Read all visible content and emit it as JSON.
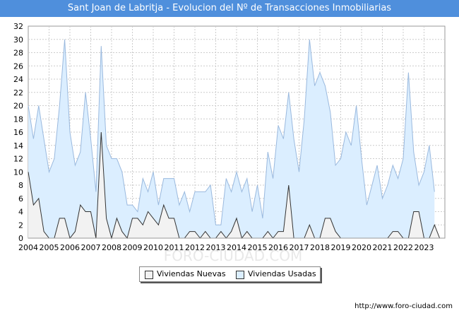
{
  "title": "Sant Joan de Labritja - Evolucion del Nº de Transacciones Inmobiliarias",
  "footer": "http://www.foro-ciudad.com",
  "watermark": "FORO-CIUDAD.COM",
  "colors": {
    "title_bg": "#4f8fdc",
    "usadas_fill": "#dbeeff",
    "usadas_line": "#9ab9de",
    "nuevas_fill": "#f2f2f2",
    "nuevas_line": "#333333",
    "grid": "#cccccc"
  },
  "chart_data": {
    "type": "area",
    "title": "Sant Joan de Labritja - Evolucion del Nº de Transacciones Inmobiliarias",
    "xlabel": "",
    "ylabel": "",
    "ylim": [
      0,
      32
    ],
    "y_ticks": [
      "0",
      "2",
      "4",
      "6",
      "8",
      "10",
      "12",
      "14",
      "16",
      "18",
      "20",
      "22",
      "24",
      "26",
      "28",
      "30",
      "32"
    ],
    "x_ticks": [
      "2004",
      "2005",
      "2006",
      "2007",
      "2008",
      "2009",
      "2010",
      "2011",
      "2012",
      "2013",
      "2014",
      "2015",
      "2016",
      "2017",
      "2018",
      "2019",
      "2020",
      "2021",
      "2022",
      "2023"
    ],
    "x_start": 2004,
    "periods_per_year": 4,
    "grid": true,
    "legend_position": "bottom",
    "series": [
      {
        "name": "Viviendas Usadas",
        "values": [
          20,
          15,
          20,
          15,
          10,
          12,
          20,
          30,
          16,
          11,
          13,
          22,
          15,
          7,
          29,
          14,
          12,
          12,
          10,
          5,
          5,
          4,
          9,
          7,
          10,
          5,
          9,
          9,
          9,
          5,
          7,
          4,
          7,
          7,
          7,
          8,
          2,
          2,
          9,
          7,
          10,
          7,
          9,
          4,
          8,
          3,
          13,
          9,
          17,
          15,
          22,
          15,
          10,
          18,
          30,
          23,
          25,
          23,
          19,
          11,
          12,
          16,
          14,
          20,
          12,
          5,
          8,
          11,
          6,
          8,
          11,
          9,
          12,
          25,
          13,
          8,
          10,
          14,
          7
        ],
        "color": "#9ab9de"
      },
      {
        "name": "Viviendas Nuevas",
        "values": [
          10,
          5,
          6,
          1,
          0,
          0,
          3,
          3,
          0,
          1,
          5,
          4,
          4,
          0,
          16,
          3,
          0,
          3,
          1,
          0,
          3,
          3,
          2,
          4,
          3,
          2,
          5,
          3,
          3,
          0,
          0,
          1,
          1,
          0,
          1,
          0,
          0,
          1,
          0,
          1,
          3,
          0,
          1,
          0,
          0,
          0,
          1,
          0,
          1,
          1,
          8,
          0,
          0,
          0,
          2,
          0,
          0,
          3,
          3,
          1,
          0,
          0,
          0,
          0,
          0,
          0,
          0,
          0,
          0,
          0,
          1,
          1,
          0,
          0,
          4,
          4,
          0,
          0,
          2,
          0
        ],
        "color": "#333333"
      }
    ]
  }
}
